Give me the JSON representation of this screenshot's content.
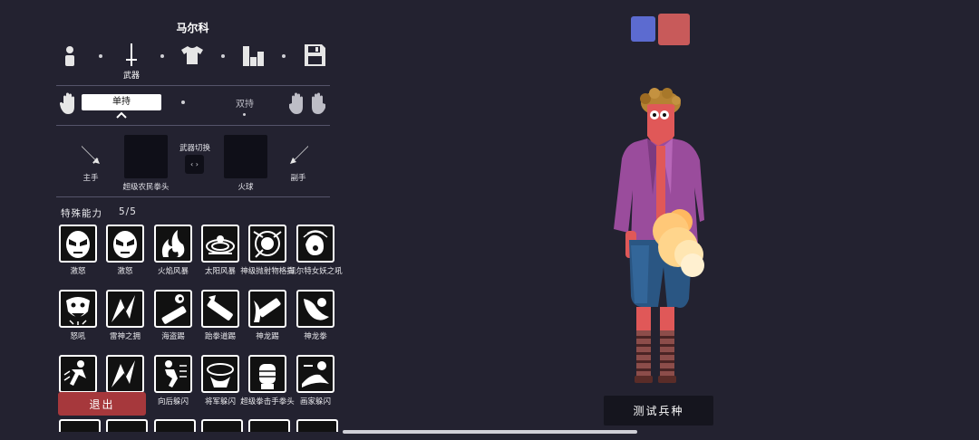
{
  "unit_name": "马尔科",
  "nav": {
    "weapon_label": "武器",
    "icons": [
      "person-icon",
      "sword-icon",
      "shirt-icon",
      "stats-icon",
      "save-icon"
    ]
  },
  "hand_mode": {
    "active": "单持",
    "other": "双持"
  },
  "weapons": {
    "main_hand_label": "主手",
    "main_weapon_name": "超级农民拳头",
    "swap_label": "武器切换",
    "swap_glyph": "‹ ›",
    "offhand_weapon_name": "火球",
    "off_hand_label": "副手"
  },
  "abilities": {
    "title": "特殊能力",
    "count": "5/5",
    "rows": [
      [
        {
          "label": "激怒",
          "icon": "angry-face-icon"
        },
        {
          "label": "激怒",
          "icon": "angry-face-icon"
        },
        {
          "label": "火焰风暴",
          "icon": "fire-storm-icon"
        },
        {
          "label": "太阳风暴",
          "icon": "sun-storm-icon"
        },
        {
          "label": "神级抛射物格挡",
          "icon": "projectile-block-icon"
        },
        {
          "label": "凯尔特女妖之吼",
          "icon": "banshee-scream-icon"
        }
      ],
      [
        {
          "label": "怒吼",
          "icon": "roar-icon"
        },
        {
          "label": "雷神之拥",
          "icon": "lightning-icon"
        },
        {
          "label": "海盗踢",
          "icon": "pirate-kick-icon"
        },
        {
          "label": "跆拳道踢",
          "icon": "taekwondo-kick-icon"
        },
        {
          "label": "神龙踢",
          "icon": "dragon-kick-icon"
        },
        {
          "label": "神龙拳",
          "icon": "dragon-punch-icon"
        }
      ],
      [
        {
          "label": "",
          "icon": "dodge-icon"
        },
        {
          "label": "",
          "icon": "lightning-icon"
        },
        {
          "label": "向后躲闪",
          "icon": "backward-dodge-icon"
        },
        {
          "label": "将军躲闪",
          "icon": "general-dodge-icon"
        },
        {
          "label": "超级拳击手拳头",
          "icon": "boxer-fist-icon"
        },
        {
          "label": "画家躲闪",
          "icon": "painter-dodge-icon"
        }
      ]
    ]
  },
  "exit_label": "退出",
  "test_button_label": "测试兵种",
  "colors": {
    "team_blue": "#5c6bd0",
    "team_red": "#c85a5a",
    "exit_red": "#a6383c"
  }
}
